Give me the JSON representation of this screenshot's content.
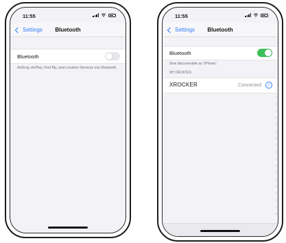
{
  "left_phone": {
    "status": {
      "time": "11:55"
    },
    "nav": {
      "back_label": "Settings",
      "title": "Bluetooth"
    },
    "bluetooth_row": {
      "label": "Bluetooth",
      "toggle_state": "off"
    },
    "footnote": "AirDrop, AirPlay, Find My, and Location Services use Bluetooth."
  },
  "right_phone": {
    "status": {
      "time": "11:55"
    },
    "nav": {
      "back_label": "Settings",
      "title": "Bluetooth"
    },
    "bluetooth_row": {
      "label": "Bluetooth",
      "toggle_state": "on"
    },
    "discoverable_text": "Now discoverable as \"iPhone\".",
    "section_header": "MY DEVICES",
    "device": {
      "name": "XROCKER",
      "status": "Connected"
    }
  },
  "colors": {
    "accent_blue": "#2f7cf6",
    "toggle_on_green": "#3dc05a",
    "toggle_off_gray": "#e6e6ea"
  }
}
